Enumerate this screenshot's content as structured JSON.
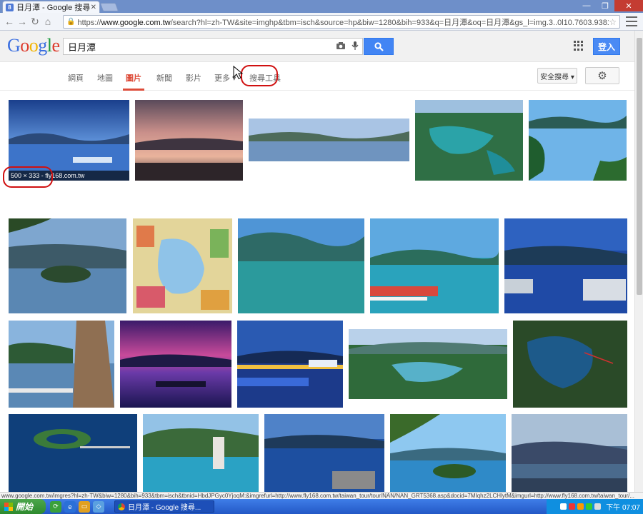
{
  "browser": {
    "tab_title": "日月潭 - Google 搜尋",
    "tab_favicon": "8",
    "url_scheme": "https://",
    "url_host": "www.google.com.tw",
    "url_rest": "/search?hl=zh-TW&site=imghp&tbm=isch&source=hp&biw=1280&bih=933&q=日月潭&oq=日月潭&gs_l=img.3..0l10.7603.9381.0.10279.6"
  },
  "google": {
    "logo_letters": [
      "G",
      "o",
      "o",
      "g",
      "l",
      "e"
    ],
    "search_query": "日月潭",
    "signin_label": "登入",
    "tabs": [
      {
        "label": "網頁"
      },
      {
        "label": "地圖"
      },
      {
        "label": "圖片"
      },
      {
        "label": "新聞"
      },
      {
        "label": "影片"
      },
      {
        "label": "更多 ▾"
      },
      {
        "label": "搜尋工具"
      }
    ],
    "safesearch_label": "安全搜尋 ▾"
  },
  "results": {
    "hover_caption": "500 × 333 - fly168.com.tw",
    "images": [
      {
        "desc": "lake-blue-sky"
      },
      {
        "desc": "lake-sunset-pink"
      },
      {
        "desc": "lake-panorama"
      },
      {
        "desc": "lake-aerial-green"
      },
      {
        "desc": "lake-blue-hills"
      },
      {
        "desc": "lake-island-trees"
      },
      {
        "desc": "lake-map"
      },
      {
        "desc": "lake-teal-mountain"
      },
      {
        "desc": "lake-red-boats"
      },
      {
        "desc": "lake-pier-blue"
      },
      {
        "desc": "stone-monument"
      },
      {
        "desc": "purple-sunset"
      },
      {
        "desc": "night-pier"
      },
      {
        "desc": "aerial-valley"
      },
      {
        "desc": "satellite-map"
      },
      {
        "desc": "island-ring"
      },
      {
        "desc": "tower-lake"
      },
      {
        "desc": "blue-docks"
      },
      {
        "desc": "island-branches"
      },
      {
        "desc": "misty-mountains"
      }
    ]
  },
  "statusbar": {
    "text": "www.google.com.tw/imgres?hl=zh-TW&biw=1280&bih=933&tbm=isch&tbnid=HbdJPGyc0YjoqM:&imgrefurl=http://www.fly168.com.tw/taiwan_tour/tour/NAN/NAN_GRT5368.asp&docid=7MIqhz2LCHlytM&imgurl=http://www.fly168.com.tw/taiwan_tour/..."
  },
  "taskbar": {
    "start_label": "開始",
    "task_label": "日月潭 - Google 搜尋...",
    "clock": "下午 07:07"
  }
}
